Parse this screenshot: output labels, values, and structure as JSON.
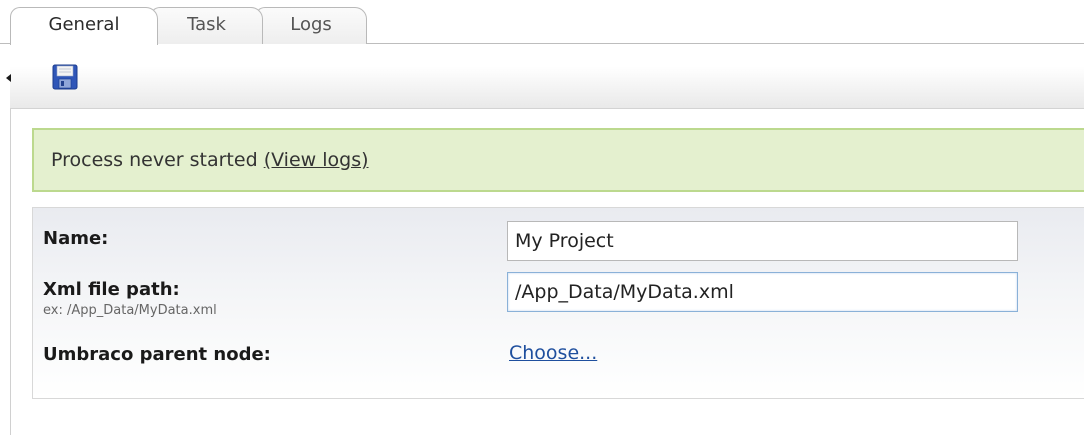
{
  "tabs": [
    {
      "label": "General",
      "active": true
    },
    {
      "label": "Task",
      "active": false
    },
    {
      "label": "Logs",
      "active": false
    }
  ],
  "toolbar": {
    "collapse_icon": "triangle-left-icon",
    "save_icon": "floppy-disk-icon"
  },
  "status": {
    "message": "Process never started",
    "link_label": "(View logs)",
    "background_color": "#e4f0cf",
    "border_color": "#bcd98e"
  },
  "form": {
    "name": {
      "label": "Name:",
      "value": "My Project"
    },
    "xml_path": {
      "label": "Xml file path:",
      "hint": "ex: /App_Data/MyData.xml",
      "value": "/App_Data/MyData.xml"
    },
    "parent_node": {
      "label": "Umbraco parent node:",
      "link_label": "Choose..."
    }
  },
  "colors": {
    "link": "#1f4f9e",
    "focus_border": "#8ab1d8"
  }
}
